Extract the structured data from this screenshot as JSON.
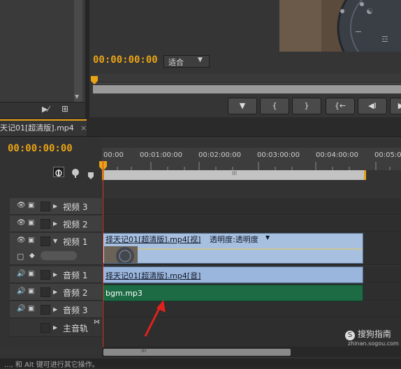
{
  "program_monitor": {
    "timecode": "00:00:00:00",
    "fit_select": "适合",
    "transport_buttons": [
      "▼",
      "{",
      "}",
      "{←",
      "◀I",
      "▶"
    ]
  },
  "sequence_tab": {
    "label": "天记01[超清版].mp4",
    "close": "×"
  },
  "timeline": {
    "timecode": "00:00:00:00",
    "ruler_ticks": [
      "00:00",
      "00:01:00:00",
      "00:02:00:00",
      "00:03:00:00",
      "00:04:00:00",
      "00:05:0"
    ],
    "scroll_grip": "III",
    "tracks": {
      "video3": "视频 3",
      "video2": "视频 2",
      "video1": "视频 1",
      "audio1": "音频 1",
      "audio2": "音频 2",
      "audio3": "音频 3",
      "master": "主音轨"
    },
    "clips": {
      "video": "择天记01[超清版].mp4[视]",
      "video_opacity": "透明度:透明度",
      "audio": "择天记01[超清版].mp4[音]",
      "bgm": "bgm.mp3"
    }
  },
  "status_bar": "..., 和 Alt 键可进行其它操作。",
  "watermark": {
    "brand": "搜狗指南",
    "url": "zhinan.sogou.com"
  },
  "colors": {
    "accent": "#e8a317",
    "playhead": "#d43a2a",
    "video_clip": "#a7c0e0",
    "bgm_clip": "#1d6b44"
  }
}
